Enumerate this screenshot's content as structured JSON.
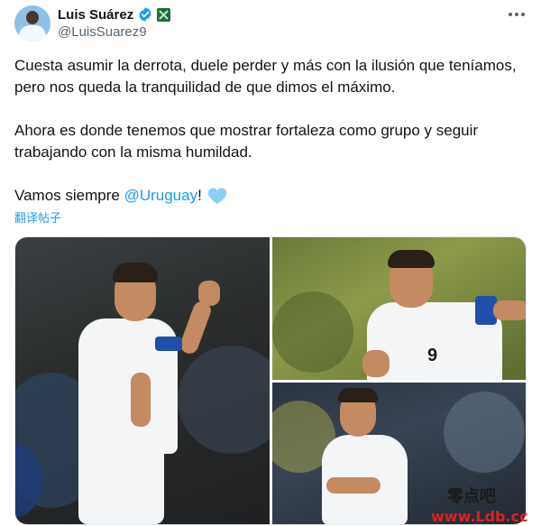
{
  "author": {
    "display_name": "Luis Suárez",
    "handle": "@LuisSuarez9",
    "verified_icon": "verified-badge-icon",
    "affiliate_icon": "affiliate-badge-icon"
  },
  "tweet": {
    "paragraph1": "Cuesta asumir la derrota, duele perder y más con la ilusión que teníamos, pero nos queda la tranquilidad de que dimos el máximo.",
    "paragraph2": "Ahora es donde tenemos que mostrar fortaleza como grupo y seguir trabajando con la misma humildad.",
    "paragraph3_prefix": "Vamos siempre ",
    "mention": "@Uruguay",
    "paragraph3_suffix": "!",
    "emoji": "light-blue-heart",
    "translate_label": "翻译帖子"
  },
  "photos": [
    {
      "name": "photo-player-pointing"
    },
    {
      "name": "photo-player-number-9"
    },
    {
      "name": "photo-player-celebrating"
    }
  ],
  "watermark": {
    "line1": "零点吧",
    "line2": "www.Ldb.cc"
  },
  "colors": {
    "link": "#1d9bf0",
    "secondary_text": "#536471",
    "heart": "#8ecdf7"
  }
}
